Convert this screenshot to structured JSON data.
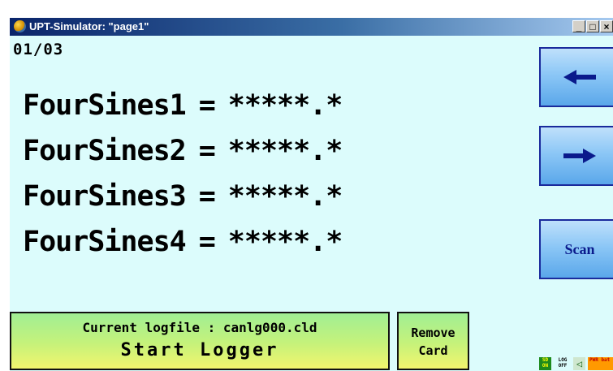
{
  "window": {
    "title": "UPT-Simulator: \"page1\"",
    "minimize_label": "_",
    "maximize_label": "□",
    "close_label": "×"
  },
  "screen": {
    "page_counter": "01/03",
    "variables": [
      {
        "name": "FourSines1",
        "eq": "=",
        "value": "*****.*"
      },
      {
        "name": "FourSines2",
        "eq": "=",
        "value": "*****.*"
      },
      {
        "name": "FourSines3",
        "eq": "=",
        "value": "*****.*"
      },
      {
        "name": "FourSines4",
        "eq": "=",
        "value": "*****.*"
      }
    ],
    "nav": {
      "prev_icon": "arrow-left-icon",
      "next_icon": "arrow-right-icon",
      "scan_label": "Scan"
    },
    "logger": {
      "logfile_text": "Current logfile : canlg000.cld",
      "start_label": "Start Logger"
    },
    "remove_card": {
      "line1": "Remove",
      "line2": "Card"
    },
    "status": {
      "sd": "SD ON",
      "log": "LOG OFF",
      "speaker_icon": "speaker-icon",
      "power": "PWR bat"
    }
  },
  "colors": {
    "screen_bg": "#dcfcfc",
    "nav_button": "#8cc7f6",
    "logger_button_top": "#a0ef94",
    "logger_button_bottom": "#f2f56e"
  }
}
